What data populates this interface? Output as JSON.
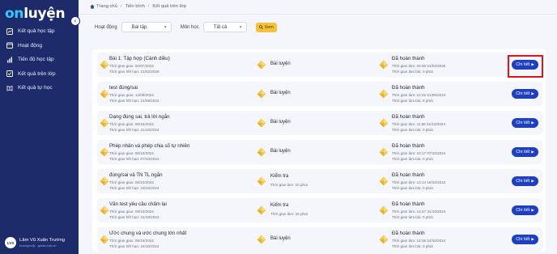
{
  "brand": {
    "logo_prefix": "on",
    "logo_main": "luyện"
  },
  "sidebar": {
    "collapse_icon": "chevron-left-icon",
    "items": [
      {
        "label": "Kết quả học tập",
        "icon": "results-icon"
      },
      {
        "label": "Hoạt động",
        "icon": "activity-icon"
      },
      {
        "label": "Tiến độ học tập",
        "icon": "progress-icon"
      },
      {
        "label": "Kết quả trên lớp",
        "icon": "class-results-icon"
      },
      {
        "label": "Kết quả tự học",
        "icon": "self-study-icon"
      }
    ],
    "user": {
      "initials": "LVX",
      "name": "Lâm Vũ Xuân Trường",
      "email": "truongvx@...gmail.edu.vn"
    }
  },
  "breadcrumb": [
    "Trang chủ",
    "Tiến trình",
    "Kết quả trên lớp"
  ],
  "filters": {
    "activity_label": "Hoạt động",
    "activity_value": "Bài tập",
    "subject_label": "Môn học",
    "subject_value": "Tất cả",
    "button_label": "Xem",
    "button_icon": "search-icon"
  },
  "colors": {
    "sidebar": "#1d2b6b",
    "accent_button": "#1e3fbf",
    "filter_button": "#f5c13a",
    "highlight": "#e0141b",
    "icon_diamond": "#f2c94c"
  },
  "list": {
    "detail_label": "Chi tiết",
    "rows": [
      {
        "title": "Bài 1: Tập hợp (Cánh diều)",
        "assigned": "Thời gian giao: 00/07/2024",
        "deadline": "Thời gian hết hạn: 21/02/2025",
        "type": "Bài luyện",
        "type_sub": "",
        "status": "Đã hoàn thành",
        "done_time": "Thời gian làm: 00:00 21/02/2025",
        "done_duration": "Thời gian làm bài: 0 phút"
      },
      {
        "title": "test đúng/sai",
        "assigned": "Thời gian giao: 14/09/2024",
        "deadline": "Thời gian hết hạn: 21/09/2024",
        "type": "Bài luyện",
        "type_sub": "",
        "status": "Đã hoàn thành",
        "done_time": "Thời gian làm: 12:02 21/09/2024",
        "done_duration": "Thời gian làm bài: 5 phút"
      },
      {
        "title": "Dạng đúng sai, trả lời ngắn",
        "assigned": "Thời gian giao: 05/10/2024",
        "deadline": "Thời gian hết hạn: 31/10/2024",
        "type": "Bài luyện",
        "type_sub": "",
        "status": "Đã hoàn thành",
        "done_time": "Thời gian làm: 11:56 31/10/2024",
        "done_duration": "Thời gian làm bài: 0 phút"
      },
      {
        "title": "Phép nhân và phép chia số tự nhiên",
        "assigned": "Thời gian giao: 06/10/2024",
        "deadline": "Thời gian hết hạn: 07/10/2024",
        "type": "Bài luyện",
        "type_sub": "",
        "status": "Đã hoàn thành",
        "done_time": "Thời gian làm: 10:17 07/10/2024",
        "done_duration": "Thời gian làm bài: 0 phút"
      },
      {
        "title": "đúng/sai và TN TL ngắn",
        "assigned": "Thời gian giao: 09/10/2024",
        "deadline": "Thời gian hết hạn: 18/10/2024",
        "type": "Kiểm tra",
        "type_sub": "Thời gian làm: 10 phút",
        "status": "Đã hoàn thành",
        "done_time": "Thời gian làm: 13:14 18/10/2024",
        "done_duration": "Thời gian làm bài: 0 phút"
      },
      {
        "title": "Văn test yêu cầu chấm lại",
        "assigned": "Thời gian giao: 09/10/2024",
        "deadline": "Thời gian hết hạn: 31/10/2024",
        "type": "Kiểm tra",
        "type_sub": "Thời gian làm: 15 phút",
        "status": "Đã hoàn thành",
        "done_time": "Thời gian làm: 13:47 31/10/2024",
        "done_duration": "Thời gian làm bài: 0 phút"
      },
      {
        "title": "Ước chung và ước chung lớn nhất",
        "assigned": "Thời gian giao: 09/10/2024",
        "deadline": "Thời gian hết hạn: 24/10/2024",
        "type": "Bài luyện",
        "type_sub": "",
        "status": "Đã hoàn thành",
        "done_time": "Thời gian làm: 14:05 24/10/2024",
        "done_duration": "Thời gian làm bài: 0 phút"
      }
    ]
  }
}
